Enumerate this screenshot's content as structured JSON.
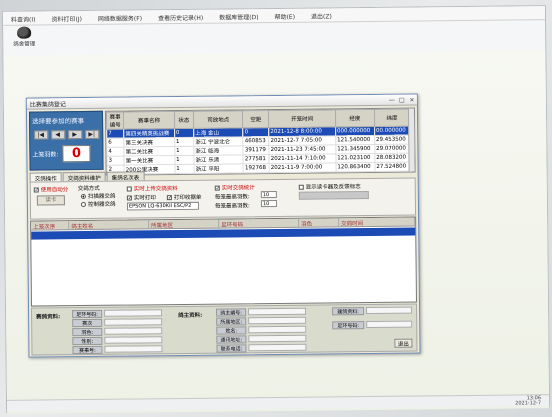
{
  "menu": [
    "料查询(I)",
    "资料打印(J)",
    "网络数据服务(F)",
    "查看历史记录(H)",
    "数据库管理(D)",
    "帮助(E)",
    "退出(Z)"
  ],
  "toolbar": {
    "label": "鸽舍管理"
  },
  "window": {
    "title": "比赛集鸽登记",
    "controls": [
      "—",
      "□",
      "×"
    ]
  },
  "left_panel": {
    "prompt": "选择要参加的赛事",
    "nav": [
      "|◀",
      "◀",
      "▶",
      "▶|"
    ],
    "count_label": "上笼羽数:",
    "count": "0"
  },
  "race_table": {
    "columns": [
      "赛事编号",
      "赛事名称",
      "状态",
      "司放地点",
      "空距",
      "开笼时间",
      "经度",
      "纬度"
    ],
    "rows": [
      [
        "7",
        "第四关精英挑战赛",
        "0",
        "上海 金山",
        "0",
        "2021-12-8 8:00:00",
        "000.000000",
        "00.000000"
      ],
      [
        "6",
        "第三关决赛",
        "1",
        "浙江 宁波北仑",
        "460853",
        "2021-12-7 7:05:00",
        "121.540000",
        "29.453500"
      ],
      [
        "4",
        "第二关比赛",
        "1",
        "浙江 临海",
        "391179",
        "2021-11-23 7:45:00",
        "121.345900",
        "29.070000"
      ],
      [
        "3",
        "第一关比赛",
        "1",
        "浙江 乐清",
        "277581",
        "2021-11-14 7:10:00",
        "121.023100",
        "28.083200"
      ],
      [
        "2",
        "200公里决赛",
        "1",
        "浙江 平阳",
        "192768",
        "2021-11-9 7:00:00",
        "120.863400",
        "27.524800"
      ]
    ],
    "selected_index": 0
  },
  "tabs": [
    "交鸽操作",
    "交鸽资料维护",
    "集鸽名次表"
  ],
  "options": {
    "use_collect": "使用自动分",
    "collect_btn": "读卡",
    "mode_label": "交鸽方式",
    "radio_scan": "扫描器交鸽",
    "radio_ctrl": "控制器交鸽",
    "realtime_upload": "实时上传交鸽资料",
    "realtime_print": "实时打印",
    "print_receipt": "打印收据单",
    "port": "EPSON LQ-630KII ESC/P2",
    "real_stats": "实时交鸽统计",
    "weight_label": "每笼最高羽数:",
    "weight_val": "10",
    "unit_label": "每笼最高羽数:",
    "unit_val": "10",
    "show_ring": "显示读卡器及反馈标志"
  },
  "grid": {
    "columns": [
      "上笼次序",
      "鸽主姓名",
      "所属地区",
      "足环号码",
      "羽色",
      "交鸽时间"
    ]
  },
  "bottom": {
    "pigeon_info": "赛鸽资料:",
    "pigeon_fields": [
      "足环号码:",
      "赛次",
      "羽色:",
      "性别:",
      "赛事号:"
    ],
    "owner_info": "鸽主资料:",
    "owner_fields": [
      "鸽主编号:",
      "所属地区:",
      "姓名:",
      "通讯地址:",
      "联系电话:"
    ],
    "right_fields": [
      "建鸽资料:",
      "足环号码:"
    ],
    "exit": "退出"
  },
  "clock": {
    "time": "13:06",
    "date": "2021-12-7"
  }
}
